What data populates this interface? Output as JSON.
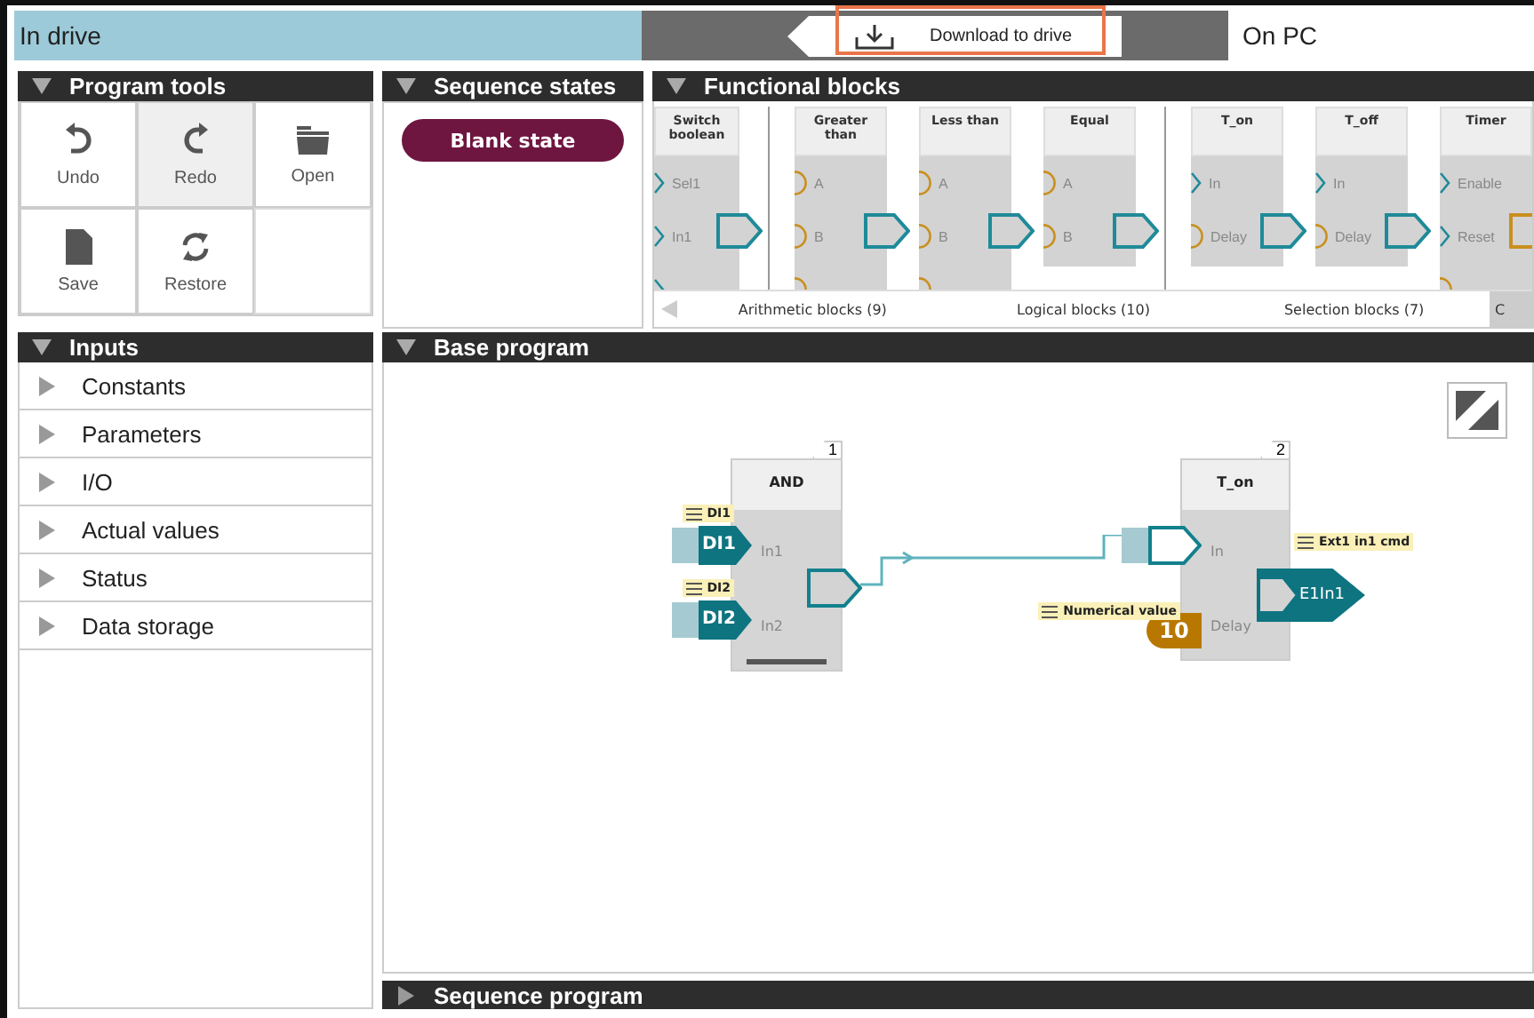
{
  "status_bar": {
    "location": "In drive",
    "action": "Download to drive",
    "target": "On PC"
  },
  "program_tools": {
    "title": "Program tools",
    "expanded": true,
    "tools": [
      {
        "label": "Undo",
        "kind": "undo",
        "selected": false
      },
      {
        "label": "Redo",
        "kind": "redo",
        "selected": true
      },
      {
        "label": "Open",
        "kind": "open",
        "selected": false
      },
      {
        "label": "Save",
        "kind": "save",
        "selected": false
      },
      {
        "label": "Restore",
        "kind": "restore",
        "selected": false
      }
    ]
  },
  "sequence_states": {
    "title": "Sequence states",
    "expanded": true,
    "states": [
      "Blank state"
    ]
  },
  "functional_blocks": {
    "title": "Functional blocks",
    "expanded": true,
    "groups": [
      {
        "blocks": [
          {
            "title": "Switch boolean",
            "inputs": [
              {
                "label": "Sel1",
                "kind": "bool"
              },
              {
                "label": "In1",
                "kind": "bool"
              },
              {
                "kind": "bool"
              }
            ],
            "output": {
              "kind": "bool"
            }
          }
        ]
      },
      {
        "blocks": [
          {
            "title": "Greater than",
            "inputs": [
              {
                "label": "A",
                "kind": "num"
              },
              {
                "label": "B",
                "kind": "num"
              },
              {
                "kind": "num"
              }
            ],
            "output": {
              "kind": "bool"
            }
          },
          {
            "title": "Less than",
            "inputs": [
              {
                "label": "A",
                "kind": "num"
              },
              {
                "label": "B",
                "kind": "num"
              },
              {
                "kind": "num"
              }
            ],
            "output": {
              "kind": "bool"
            }
          },
          {
            "title": "Equal",
            "inputs": [
              {
                "label": "A",
                "kind": "num"
              },
              {
                "label": "B",
                "kind": "num"
              }
            ],
            "output": {
              "kind": "bool"
            }
          }
        ]
      },
      {
        "blocks": [
          {
            "title": "T_on",
            "inputs": [
              {
                "label": "In",
                "kind": "bool"
              },
              {
                "label": "Delay",
                "kind": "num"
              }
            ],
            "output": {
              "kind": "bool"
            }
          },
          {
            "title": "T_off",
            "inputs": [
              {
                "label": "In",
                "kind": "bool"
              },
              {
                "label": "Delay",
                "kind": "num"
              }
            ],
            "output": {
              "kind": "bool"
            }
          },
          {
            "title": "Timer",
            "inputs": [
              {
                "label": "Enable",
                "kind": "bool"
              },
              {
                "label": "Reset",
                "kind": "bool"
              },
              {
                "kind": "num"
              }
            ],
            "output": {
              "kind": "num"
            }
          }
        ]
      }
    ],
    "tabs": [
      {
        "label": "Arithmetic blocks (9)",
        "selected": false
      },
      {
        "label": "Logical blocks (10)",
        "selected": false
      },
      {
        "label": "Selection blocks (7)",
        "selected": false
      },
      {
        "label": "C",
        "selected": true
      }
    ]
  },
  "inputs": {
    "title": "Inputs",
    "expanded": true,
    "items": [
      {
        "label": "Constants",
        "expanded": false
      },
      {
        "label": "Parameters",
        "expanded": false
      },
      {
        "label": "I/O",
        "expanded": false
      },
      {
        "label": "Actual values",
        "expanded": false
      },
      {
        "label": "Status",
        "expanded": false
      },
      {
        "label": "Data storage",
        "expanded": false
      }
    ]
  },
  "base_program": {
    "title": "Base program",
    "expanded": true,
    "blocks": [
      {
        "number": "1",
        "title": "AND",
        "inputs": [
          {
            "label": "In1",
            "kind": "bool",
            "source": {
              "tag": "DI1",
              "value": "DI1"
            }
          },
          {
            "label": "In2",
            "kind": "bool",
            "source": {
              "tag": "DI2",
              "value": "DI2"
            }
          }
        ]
      },
      {
        "number": "2",
        "title": "T_on",
        "inputs": [
          {
            "label": "In",
            "kind": "bool"
          },
          {
            "label": "Delay",
            "kind": "num",
            "source": {
              "tag": "Numerical value",
              "value": "10"
            }
          }
        ],
        "target": {
          "tag": "Ext1 in1 cmd",
          "value": "E1In1"
        }
      }
    ]
  },
  "sequence_program": {
    "title": "Sequence program",
    "expanded": false
  }
}
